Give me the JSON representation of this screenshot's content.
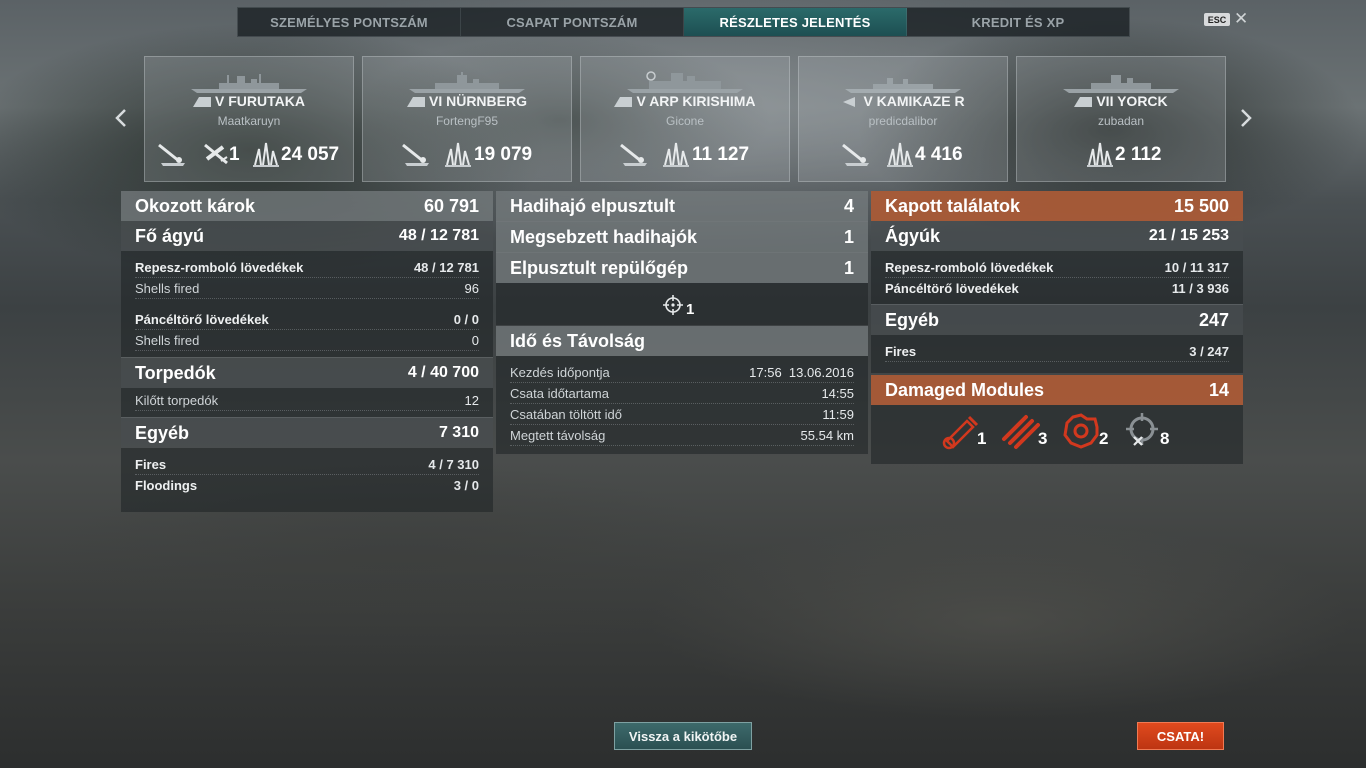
{
  "tabs": [
    "SZEMÉLYES PONTSZÁM",
    "CSAPAT PONTSZÁM",
    "RÉSZLETES JELENTÉS",
    "KREDIT ÉS XP"
  ],
  "active_tab": 2,
  "esc_label": "ESC",
  "close_glyph": "✕",
  "colors": {
    "accent_tab": "#2b6a6a",
    "received_header": "#b86038",
    "battle_button": "#e04a1e",
    "module_damage": "#d2381e"
  },
  "ships": [
    {
      "tier_name": "V FURUTAKA",
      "player": "Maatkaruyn",
      "stats": [
        {
          "icon": "torpedo-hit-icon",
          "value": ""
        },
        {
          "icon": "plane-icon",
          "value": "1"
        },
        {
          "icon": "damage-splash-icon",
          "value": "24 057"
        }
      ]
    },
    {
      "tier_name": "VI NÜRNBERG",
      "player": "FortengF95",
      "stats": [
        {
          "icon": "torpedo-hit-icon",
          "value": ""
        },
        {
          "icon": "damage-splash-icon",
          "value": "19 079"
        }
      ]
    },
    {
      "tier_name": "V ARP KIRISHIMA",
      "player": "Gicone",
      "stats": [
        {
          "icon": "torpedo-hit-icon",
          "value": ""
        },
        {
          "icon": "damage-splash-icon",
          "value": "11 127"
        }
      ]
    },
    {
      "tier_name": "V KAMIKAZE R",
      "player": "predicdalibor",
      "stats": [
        {
          "icon": "torpedo-hit-icon",
          "value": ""
        },
        {
          "icon": "damage-splash-icon",
          "value": "4 416"
        }
      ]
    },
    {
      "tier_name": "VII YORCK",
      "player": "zubadan",
      "stats": [
        {
          "icon": "damage-splash-icon",
          "value": "2 112"
        }
      ]
    }
  ],
  "damage": {
    "title": "Okozott károk",
    "total": "60 791",
    "main_guns": {
      "label": "Fő ágyú",
      "value": "48 / 12 781"
    },
    "he": {
      "label": "Repesz-romboló lövedékek",
      "value": "48 / 12 781"
    },
    "he_fired": {
      "label": "Shells fired",
      "value": "96"
    },
    "ap": {
      "label": "Páncéltörő lövedékek",
      "value": "0 / 0"
    },
    "ap_fired": {
      "label": "Shells fired",
      "value": "0"
    },
    "torpedoes": {
      "label": "Torpedók",
      "value": "4 / 40 700"
    },
    "torps_launched": {
      "label": "Kilőtt torpedók",
      "value": "12"
    },
    "other": {
      "label": "Egyéb",
      "value": "7 310"
    },
    "fires": {
      "label": "Fires",
      "value": "4 / 7 310"
    },
    "floodings": {
      "label": "Floodings",
      "value": "3 / 0"
    }
  },
  "kills": {
    "destroyed": {
      "label": "Hadihajó elpusztult",
      "value": "4"
    },
    "damaged": {
      "label": "Megsebzett hadihajók",
      "value": "1"
    },
    "planes": {
      "label": "Elpusztult repülőgép",
      "value": "1"
    },
    "crosshair_count": "1"
  },
  "time": {
    "title": "Idő és Távolság",
    "start": {
      "label": "Kezdés időpontja",
      "value": "17:56  13.06.2016"
    },
    "duration": {
      "label": "Csata időtartama",
      "value": "14:55"
    },
    "in_battle": {
      "label": "Csatában töltött idő",
      "value": "11:59"
    },
    "distance": {
      "label": "Megtett távolság",
      "value": "55.54 km"
    }
  },
  "received": {
    "title": "Kapott találatok",
    "total": "15 500",
    "guns": {
      "label": "Ágyúk",
      "value": "21 / 15 253"
    },
    "he": {
      "label": "Repesz-romboló lövedékek",
      "value": "10 / 11 317"
    },
    "ap": {
      "label": "Páncéltörő lövedékek",
      "value": "11 / 3 936"
    },
    "other": {
      "label": "Egyéb",
      "value": "247"
    },
    "fires": {
      "label": "Fires",
      "value": "3 / 247"
    }
  },
  "modules": {
    "title": "Damaged Modules",
    "total": "14",
    "items": [
      {
        "icon": "main-battery-module-icon",
        "count": "1"
      },
      {
        "icon": "torpedo-tubes-module-icon",
        "count": "3"
      },
      {
        "icon": "engine-module-icon",
        "count": "2"
      },
      {
        "icon": "aa-module-destroyed-icon",
        "count": "8"
      }
    ]
  },
  "buttons": {
    "port": "Vissza a kikötőbe",
    "battle": "CSATA!"
  }
}
